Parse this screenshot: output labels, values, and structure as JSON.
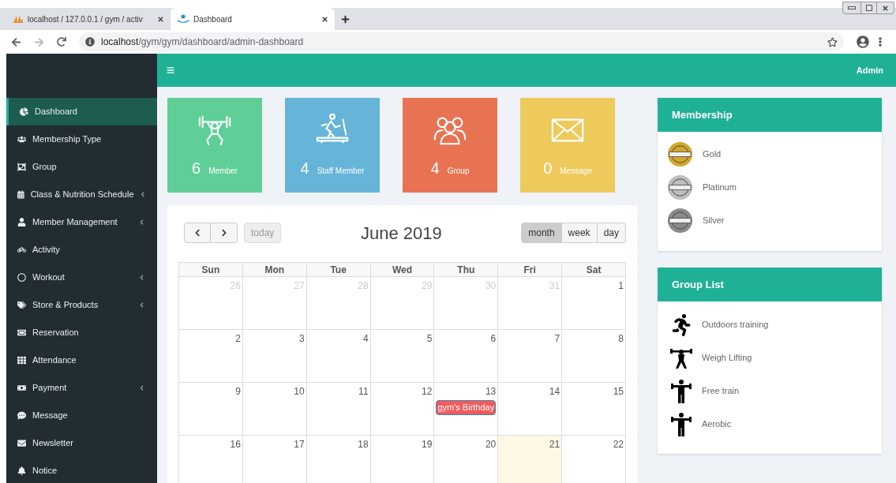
{
  "browser": {
    "tabs": [
      {
        "title": "localhost / 127.0.0.1 / gym / activ",
        "selected": false
      },
      {
        "title": "Dashboard",
        "selected": true
      }
    ],
    "url": {
      "host": "localhost",
      "path": "/gym/gym/dashboard/admin-dashboard"
    }
  },
  "header": {
    "user": "Admin"
  },
  "sidebar": {
    "items": [
      {
        "label": "Dashboard",
        "selected": true,
        "has_submenu": false
      },
      {
        "label": "Membership Type",
        "selected": false,
        "has_submenu": false
      },
      {
        "label": "Group",
        "selected": false,
        "has_submenu": false
      },
      {
        "label": "Class & Nutrition Schedule",
        "selected": false,
        "has_submenu": true
      },
      {
        "label": "Member Management",
        "selected": false,
        "has_submenu": true
      },
      {
        "label": "Activity",
        "selected": false,
        "has_submenu": false
      },
      {
        "label": "Workout",
        "selected": false,
        "has_submenu": true
      },
      {
        "label": "Store & Products",
        "selected": false,
        "has_submenu": true
      },
      {
        "label": "Reservation",
        "selected": false,
        "has_submenu": false
      },
      {
        "label": "Attendance",
        "selected": false,
        "has_submenu": false
      },
      {
        "label": "Payment",
        "selected": false,
        "has_submenu": true
      },
      {
        "label": "Message",
        "selected": false,
        "has_submenu": false
      },
      {
        "label": "Newsletter",
        "selected": false,
        "has_submenu": false
      },
      {
        "label": "Notice",
        "selected": false,
        "has_submenu": false
      }
    ]
  },
  "stats": [
    {
      "count": "6",
      "label": "Member",
      "color": "#5fcf97"
    },
    {
      "count": "4",
      "label": "Staff Member",
      "color": "#66b4d8"
    },
    {
      "count": "4",
      "label": "Group",
      "color": "#e87352"
    },
    {
      "count": "0",
      "label": "Message",
      "color": "#eec95b"
    }
  ],
  "calendar": {
    "title": "June 2019",
    "today_button": {
      "label": "today",
      "disabled": true
    },
    "views": [
      {
        "label": "month",
        "selected": true
      },
      {
        "label": "week",
        "selected": false
      },
      {
        "label": "day",
        "selected": false
      }
    ],
    "weekdays": [
      "Sun",
      "Mon",
      "Tue",
      "Wed",
      "Thu",
      "Fri",
      "Sat"
    ],
    "weeks": [
      [
        {
          "day": "26",
          "other_month": true,
          "today": false
        },
        {
          "day": "27",
          "other_month": true,
          "today": false
        },
        {
          "day": "28",
          "other_month": true,
          "today": false
        },
        {
          "day": "29",
          "other_month": true,
          "today": false
        },
        {
          "day": "30",
          "other_month": true,
          "today": false
        },
        {
          "day": "31",
          "other_month": true,
          "today": false
        },
        {
          "day": "1",
          "other_month": false,
          "today": false
        }
      ],
      [
        {
          "day": "2",
          "other_month": false,
          "today": false
        },
        {
          "day": "3",
          "other_month": false,
          "today": false
        },
        {
          "day": "4",
          "other_month": false,
          "today": false
        },
        {
          "day": "5",
          "other_month": false,
          "today": false
        },
        {
          "day": "6",
          "other_month": false,
          "today": false
        },
        {
          "day": "7",
          "other_month": false,
          "today": false
        },
        {
          "day": "8",
          "other_month": false,
          "today": false
        }
      ],
      [
        {
          "day": "9",
          "other_month": false,
          "today": false
        },
        {
          "day": "10",
          "other_month": false,
          "today": false
        },
        {
          "day": "11",
          "other_month": false,
          "today": false
        },
        {
          "day": "12",
          "other_month": false,
          "today": false
        },
        {
          "day": "13",
          "other_month": false,
          "today": false,
          "events": [
            {
              "title": "gym's Birthday",
              "color": "#f15b5b"
            }
          ]
        },
        {
          "day": "14",
          "other_month": false,
          "today": false
        },
        {
          "day": "15",
          "other_month": false,
          "today": false
        }
      ],
      [
        {
          "day": "16",
          "other_month": false,
          "today": false
        },
        {
          "day": "17",
          "other_month": false,
          "today": false
        },
        {
          "day": "18",
          "other_month": false,
          "today": false
        },
        {
          "day": "19",
          "other_month": false,
          "today": false
        },
        {
          "day": "20",
          "other_month": false,
          "today": false
        },
        {
          "day": "21",
          "other_month": false,
          "today": true
        },
        {
          "day": "22",
          "other_month": false,
          "today": false
        }
      ]
    ]
  },
  "membership": {
    "title": "Membership",
    "items": [
      {
        "name": "Gold",
        "color": "#d4a72c"
      },
      {
        "name": "Platinum",
        "color": "#bdbdbd"
      },
      {
        "name": "Silver",
        "color": "#8a8a8a"
      }
    ]
  },
  "group_list": {
    "title": "Group List",
    "items": [
      {
        "name": "Outdoors training"
      },
      {
        "name": "Weigh Lifting"
      },
      {
        "name": "Free train"
      },
      {
        "name": "Aerobic"
      }
    ]
  }
}
